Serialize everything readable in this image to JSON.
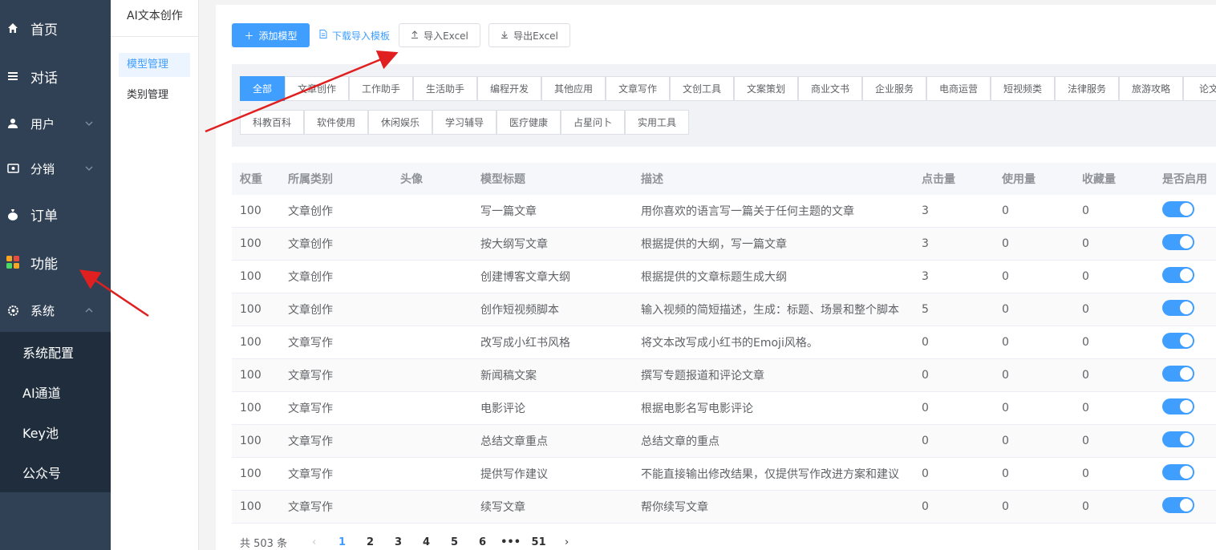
{
  "sidebar": {
    "items": [
      {
        "label": "首页",
        "icon": "home-icon"
      },
      {
        "label": "对话",
        "icon": "menu-lines-icon"
      },
      {
        "label": "用户",
        "icon": "user-icon"
      },
      {
        "label": "分销",
        "icon": "distribution-icon"
      },
      {
        "label": "订单",
        "icon": "money-bag-icon"
      },
      {
        "label": "功能",
        "icon": "apps-grid-icon"
      },
      {
        "label": "系统",
        "icon": "gear-icon"
      }
    ],
    "system_sub": [
      "系统配置",
      "AI通道",
      "Key池",
      "公众号"
    ]
  },
  "panel2": {
    "title": "AI文本创作",
    "items": [
      "模型管理",
      "类别管理"
    ]
  },
  "toolbar": {
    "add": "添加模型",
    "download": "下载导入模板",
    "import": "导入Excel",
    "export": "导出Excel"
  },
  "categories": {
    "row1": [
      "全部",
      "文章创作",
      "工作助手",
      "生活助手",
      "编程开发",
      "其他应用",
      "文章写作",
      "文创工具",
      "文案策划",
      "商业文书",
      "企业服务",
      "电商运营",
      "短视频类",
      "法律服务",
      "旅游攻略",
      "论文"
    ],
    "row2": [
      "科教百科",
      "软件使用",
      "休闲娱乐",
      "学习辅导",
      "医疗健康",
      "占星问卜",
      "实用工具"
    ]
  },
  "table": {
    "headers": [
      "权重",
      "所属类别",
      "头像",
      "模型标题",
      "描述",
      "点击量",
      "使用量",
      "收藏量",
      "是否启用"
    ],
    "rows": [
      [
        "100",
        "文章创作",
        "",
        "写一篇文章",
        "用你喜欢的语言写一篇关于任何主题的文章",
        "3",
        "0",
        "0"
      ],
      [
        "100",
        "文章创作",
        "",
        "按大纲写文章",
        "根据提供的大纲，写一篇文章",
        "3",
        "0",
        "0"
      ],
      [
        "100",
        "文章创作",
        "",
        "创建博客文章大纲",
        "根据提供的文章标题生成大纲",
        "3",
        "0",
        "0"
      ],
      [
        "100",
        "文章创作",
        "",
        "创作短视频脚本",
        "输入视频的简短描述，生成：标题、场景和整个脚本",
        "5",
        "0",
        "0"
      ],
      [
        "100",
        "文章写作",
        "",
        "改写成小红书风格",
        "将文本改写成小红书的Emoji风格。",
        "0",
        "0",
        "0"
      ],
      [
        "100",
        "文章写作",
        "",
        "新闻稿文案",
        "撰写专题报道和评论文章",
        "0",
        "0",
        "0"
      ],
      [
        "100",
        "文章写作",
        "",
        "电影评论",
        "根据电影名写电影评论",
        "0",
        "0",
        "0"
      ],
      [
        "100",
        "文章写作",
        "",
        "总结文章重点",
        "总结文章的重点",
        "0",
        "0",
        "0"
      ],
      [
        "100",
        "文章写作",
        "",
        "提供写作建议",
        "不能直接输出修改结果，仅提供写作改进方案和建议",
        "0",
        "0",
        "0"
      ],
      [
        "100",
        "文章写作",
        "",
        "续写文章",
        "帮你续写文章",
        "0",
        "0",
        "0"
      ]
    ]
  },
  "pagination": {
    "total": "共 503 条",
    "pages": [
      "1",
      "2",
      "3",
      "4",
      "5",
      "6",
      "•••",
      "51"
    ],
    "prev": "‹",
    "next": "›"
  },
  "colors": {
    "accent": "#409eff",
    "sidebar": "#304156",
    "submenu": "#1f2d3d",
    "annotation": "#e02020"
  }
}
